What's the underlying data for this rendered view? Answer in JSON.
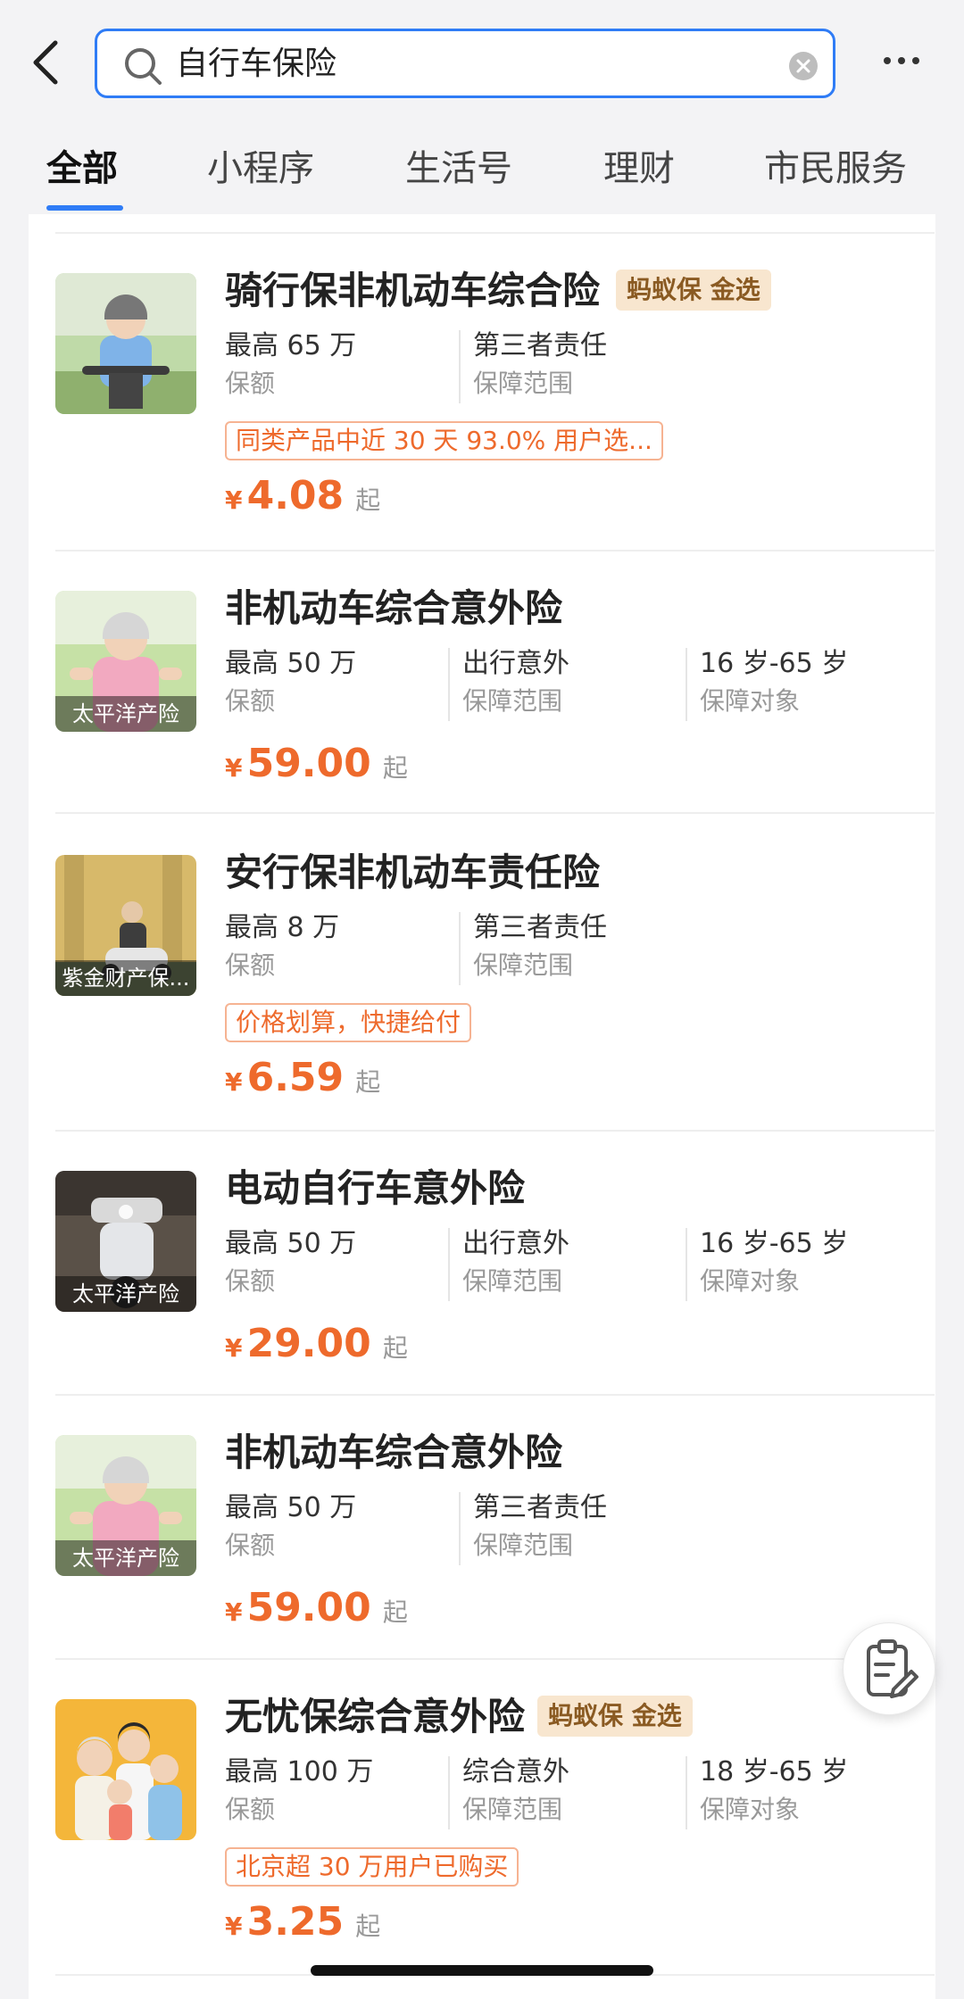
{
  "search": {
    "query": "自行车保险"
  },
  "tabs": [
    "全部",
    "小程序",
    "生活号",
    "理财",
    "市民服务"
  ],
  "products": [
    {
      "title": "骑行保非机动车综合险",
      "badge": "蚂蚁保 金选",
      "overlay": "",
      "specs": [
        {
          "value": "最高 65 万",
          "label": "保额"
        },
        {
          "value": "第三者责任",
          "label": "保障范围"
        }
      ],
      "tag": "同类产品中近 30 天 93.0% 用户选...",
      "currency": "¥",
      "price": "4.08",
      "price_suffix": "起"
    },
    {
      "title": "非机动车综合意外险",
      "badge": "",
      "overlay": "太平洋产险",
      "specs": [
        {
          "value": "最高 50 万",
          "label": "保额"
        },
        {
          "value": "出行意外",
          "label": "保障范围"
        },
        {
          "value": "16 岁-65 岁",
          "label": "保障对象"
        }
      ],
      "tag": "",
      "currency": "¥",
      "price": "59.00",
      "price_suffix": "起"
    },
    {
      "title": "安行保非机动车责任险",
      "badge": "",
      "overlay": "紫金财产保...",
      "specs": [
        {
          "value": "最高 8 万",
          "label": "保额"
        },
        {
          "value": "第三者责任",
          "label": "保障范围"
        }
      ],
      "tag": "价格划算，快捷给付",
      "currency": "¥",
      "price": "6.59",
      "price_suffix": "起"
    },
    {
      "title": "电动自行车意外险",
      "badge": "",
      "overlay": "太平洋产险",
      "specs": [
        {
          "value": "最高 50 万",
          "label": "保额"
        },
        {
          "value": "出行意外",
          "label": "保障范围"
        },
        {
          "value": "16 岁-65 岁",
          "label": "保障对象"
        }
      ],
      "tag": "",
      "currency": "¥",
      "price": "29.00",
      "price_suffix": "起"
    },
    {
      "title": "非机动车综合意外险",
      "badge": "",
      "overlay": "太平洋产险",
      "specs": [
        {
          "value": "最高 50 万",
          "label": "保额"
        },
        {
          "value": "第三者责任",
          "label": "保障范围"
        }
      ],
      "tag": "",
      "currency": "¥",
      "price": "59.00",
      "price_suffix": "起"
    },
    {
      "title": "无忧保综合意外险",
      "badge": "蚂蚁保 金选",
      "overlay": "",
      "specs": [
        {
          "value": "最高 100 万",
          "label": "保额"
        },
        {
          "value": "综合意外",
          "label": "保障范围"
        },
        {
          "value": "18 岁-65 岁",
          "label": "保障对象"
        }
      ],
      "tag": "北京超 30 万用户已购买",
      "currency": "¥",
      "price": "3.25",
      "price_suffix": "起"
    }
  ],
  "icons": {
    "back": "chevron-left-icon",
    "search": "search-icon",
    "clear": "clear-icon",
    "more": "more-icon",
    "float": "clipboard-edit-icon"
  },
  "colors": {
    "accent": "#2f7cf6",
    "price": "#ee6a2c",
    "badge_bg": "#f8e6cf",
    "badge_text": "#8a5a22"
  }
}
